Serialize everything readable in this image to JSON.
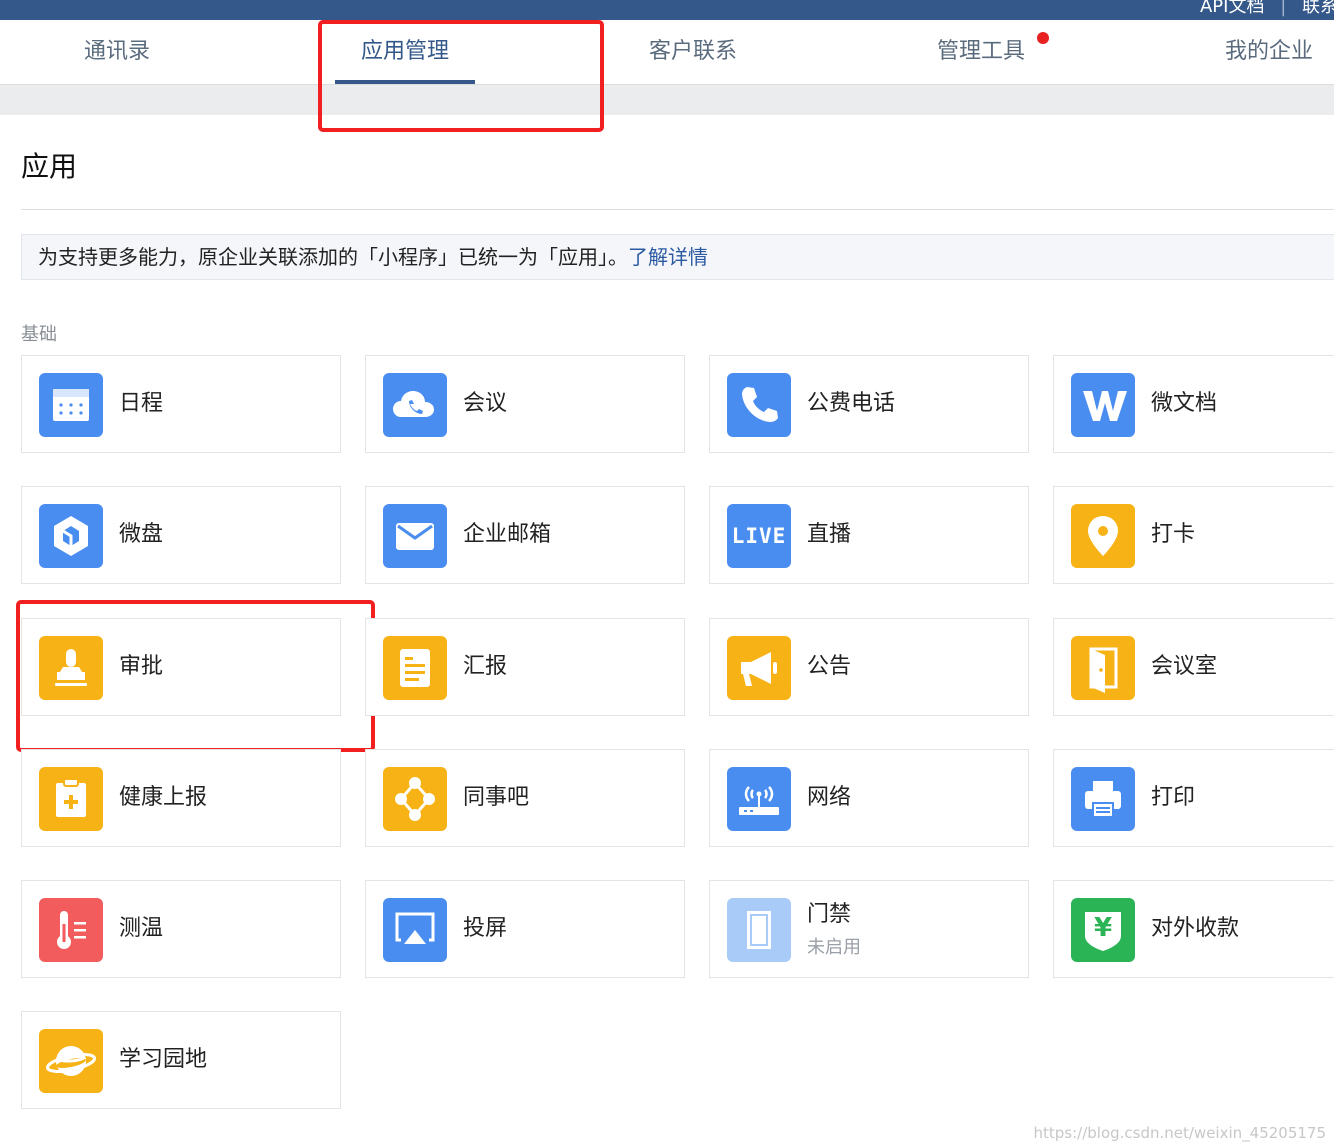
{
  "topbar": {
    "links": [
      "API文档",
      "|",
      "联系客服"
    ]
  },
  "tabs": [
    {
      "label": "通讯录"
    },
    {
      "label": "应用管理"
    },
    {
      "label": "客户联系"
    },
    {
      "label": "管理工具"
    },
    {
      "label": "我的企业"
    }
  ],
  "page": {
    "title": "应用",
    "notice_text": "为支持更多能力，原企业关联添加的「小程序」已统一为「应用」。",
    "notice_link": "了解详情",
    "section": "基础"
  },
  "apps": [
    {
      "label": "日程",
      "icon": "calendar-icon",
      "color": "#4a8df0"
    },
    {
      "label": "会议",
      "icon": "cloud-phone-icon",
      "color": "#4a8df0"
    },
    {
      "label": "公费电话",
      "icon": "phone-icon",
      "color": "#4a8df0"
    },
    {
      "label": "微文档",
      "icon": "w-doc-icon",
      "color": "#4a8df0"
    },
    {
      "label": "微盘",
      "icon": "drive-icon",
      "color": "#4a8df0"
    },
    {
      "label": "企业邮箱",
      "icon": "mail-icon",
      "color": "#4a8df0"
    },
    {
      "label": "直播",
      "icon": "live-icon",
      "color": "#4a8df0",
      "icon_text": "LIVE"
    },
    {
      "label": "打卡",
      "icon": "location-pin-icon",
      "color": "#f7b216"
    },
    {
      "label": "审批",
      "icon": "stamp-icon",
      "color": "#f7b216"
    },
    {
      "label": "汇报",
      "icon": "report-icon",
      "color": "#f7b216"
    },
    {
      "label": "公告",
      "icon": "megaphone-icon",
      "color": "#f7b216"
    },
    {
      "label": "会议室",
      "icon": "door-icon",
      "color": "#f7b216"
    },
    {
      "label": "健康上报",
      "icon": "health-clipboard-icon",
      "color": "#f7b216"
    },
    {
      "label": "同事吧",
      "icon": "network-nodes-icon",
      "color": "#f7b216"
    },
    {
      "label": "网络",
      "icon": "wifi-router-icon",
      "color": "#4a8df0"
    },
    {
      "label": "打印",
      "icon": "printer-icon",
      "color": "#4a8df0"
    },
    {
      "label": "测温",
      "icon": "thermometer-icon",
      "color": "#f25c5c"
    },
    {
      "label": "投屏",
      "icon": "screen-cast-icon",
      "color": "#4a8df0"
    },
    {
      "label": "门禁",
      "icon": "access-door-icon",
      "color": "#a9cbf8",
      "status": "未启用"
    },
    {
      "label": "对外收款",
      "icon": "yuan-shield-icon",
      "color": "#2bb456",
      "icon_text": "¥"
    },
    {
      "label": "学习园地",
      "icon": "planet-icon",
      "color": "#f7b216"
    }
  ],
  "watermark": "https://blog.csdn.net/weixin_45205175"
}
